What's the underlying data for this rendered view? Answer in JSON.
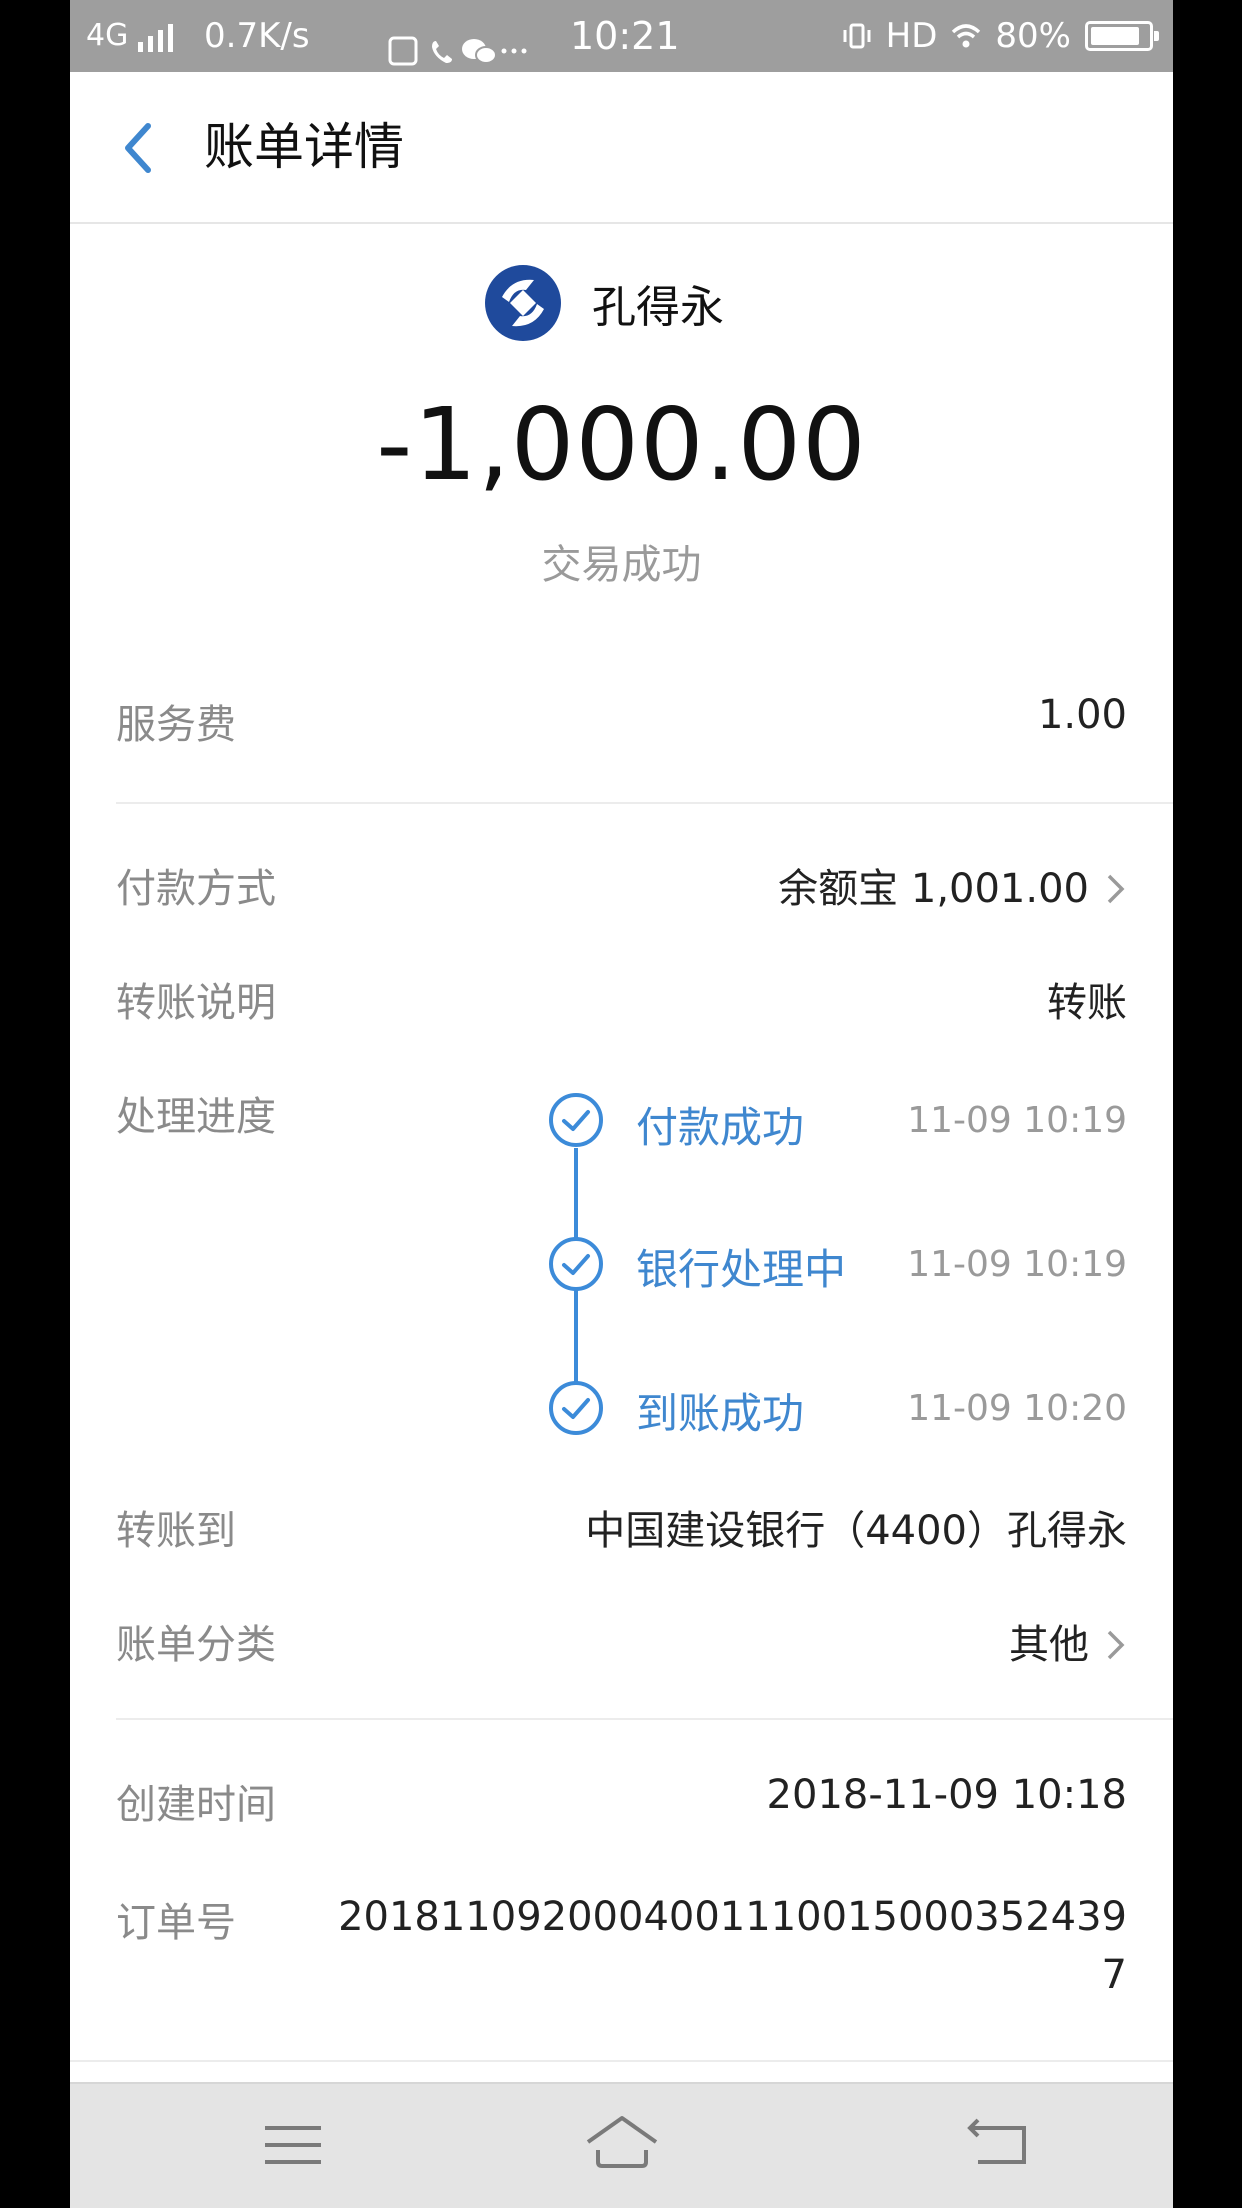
{
  "status_bar": {
    "network": "4G",
    "speed": "0.7K/s",
    "time": "10:21",
    "hd": "HD",
    "battery": "80%",
    "battery_level": 0.8
  },
  "header": {
    "title": "账单详情"
  },
  "summary": {
    "payee": "孔得永",
    "amount": "-1,000.00",
    "status": "交易成功"
  },
  "rows": {
    "service_fee": {
      "label": "服务费",
      "value": "1.00"
    },
    "payment_method": {
      "label": "付款方式",
      "value": "余额宝 1,001.00"
    },
    "transfer_note": {
      "label": "转账说明",
      "value": "转账"
    },
    "progress": {
      "label": "处理进度"
    },
    "transfer_to": {
      "label": "转账到",
      "value": "中国建设银行（4400）孔得永"
    },
    "category": {
      "label": "账单分类",
      "value": "其他"
    },
    "created": {
      "label": "创建时间",
      "value": "2018-11-09 10:18"
    },
    "order": {
      "label": "订单号",
      "value": "20181109200040011100150003524397"
    }
  },
  "progress_steps": [
    {
      "label": "付款成功",
      "time": "11-09 10:19"
    },
    {
      "label": "银行处理中",
      "time": "11-09 10:19"
    },
    {
      "label": "到账成功",
      "time": "11-09 10:20"
    }
  ],
  "colors": {
    "accent": "#3f87cf",
    "bank_logo": "#1f4a9c",
    "status_bar": "#9e9e9e",
    "nav_bar": "#e4e4e4"
  },
  "icons": {
    "back": "chevron-left-icon",
    "bank": "ccb-logo-icon",
    "step": "check-circle-icon",
    "row_more": "chevron-right-icon",
    "nav_menu": "menu-icon",
    "nav_home": "home-icon",
    "nav_back": "return-icon"
  }
}
